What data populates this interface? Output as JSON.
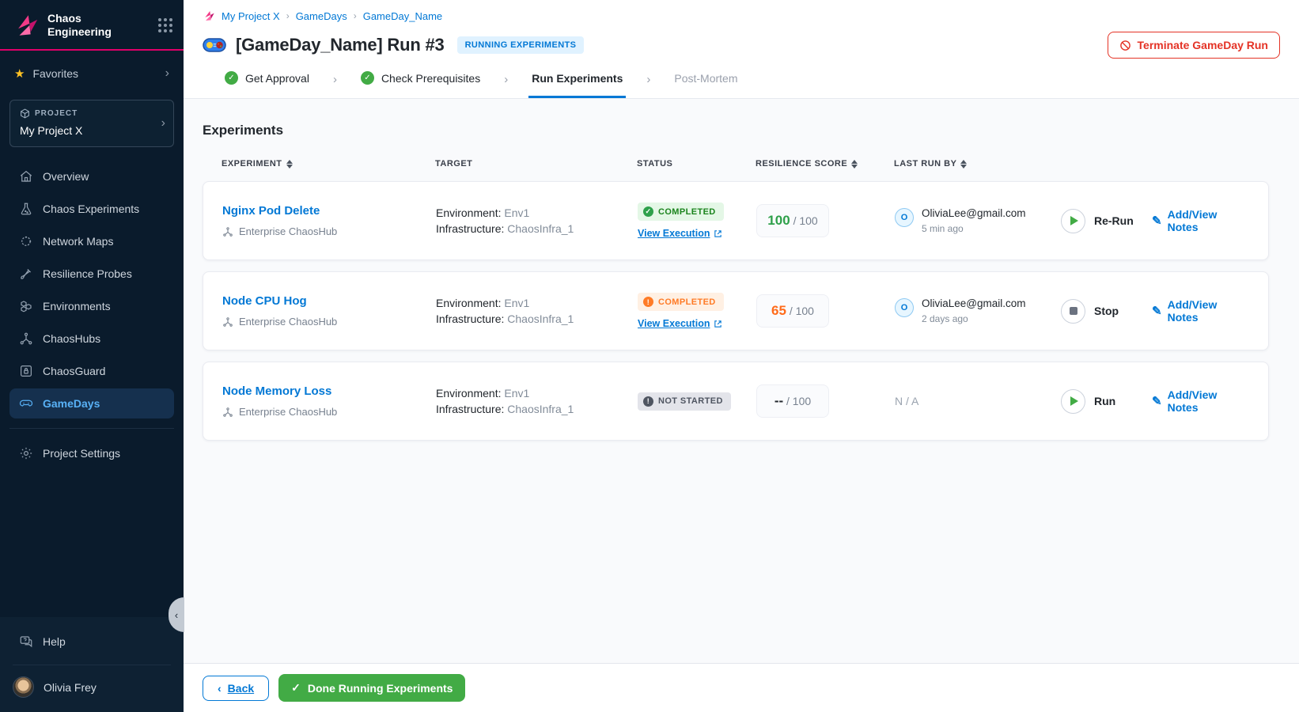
{
  "sidebar": {
    "brand": {
      "line1": "Chaos",
      "line2": "Engineering"
    },
    "favorites_label": "Favorites",
    "project": {
      "label": "PROJECT",
      "name": "My Project X"
    },
    "nav": [
      {
        "label": "Overview",
        "icon": "home-icon"
      },
      {
        "label": "Chaos Experiments",
        "icon": "flask-icon"
      },
      {
        "label": "Network Maps",
        "icon": "network-icon"
      },
      {
        "label": "Resilience Probes",
        "icon": "probe-icon"
      },
      {
        "label": "Environments",
        "icon": "hexagons-icon"
      },
      {
        "label": "ChaosHubs",
        "icon": "hub-icon"
      },
      {
        "label": "ChaosGuard",
        "icon": "lock-icon"
      },
      {
        "label": "GameDays",
        "icon": "gamepad-icon",
        "active": true
      }
    ],
    "settings_label": "Project Settings",
    "help_label": "Help",
    "user_name": "Olivia Frey"
  },
  "header": {
    "breadcrumb": [
      "My Project X",
      "GameDays",
      "GameDay_Name"
    ],
    "title": "[GameDay_Name] Run #3",
    "status_badge": "RUNNING EXPERIMENTS",
    "terminate_label": "Terminate GameDay Run",
    "steps": [
      {
        "label": "Get Approval",
        "state": "done"
      },
      {
        "label": "Check Prerequisites",
        "state": "done"
      },
      {
        "label": "Run Experiments",
        "state": "active"
      },
      {
        "label": "Post-Mortem",
        "state": "pending"
      }
    ]
  },
  "main": {
    "section_title": "Experiments",
    "columns": [
      "EXPERIMENT",
      "TARGET",
      "STATUS",
      "RESILIENCE SCORE",
      "LAST RUN BY"
    ],
    "target_labels": {
      "environment": "Environment:",
      "infrastructure": "Infrastructure:"
    },
    "rows": [
      {
        "name": "Nginx Pod Delete",
        "hub": "Enterprise ChaosHub",
        "environment": "Env1",
        "infrastructure": "ChaosInfra_1",
        "status": "COMPLETED",
        "view_execution": "View Execution",
        "score": "100",
        "score_max": "/ 100",
        "avatar_letter": "O",
        "run_by": "OliviaLee@gmail.com",
        "run_time": "5 min ago",
        "action": "Re-Run",
        "notes": "Add/View Notes"
      },
      {
        "name": "Node CPU Hog",
        "hub": "Enterprise ChaosHub",
        "environment": "Env1",
        "infrastructure": "ChaosInfra_1",
        "status": "COMPLETED",
        "view_execution": "View Execution",
        "score": "65",
        "score_max": "/ 100",
        "avatar_letter": "O",
        "run_by": "OliviaLee@gmail.com",
        "run_time": "2 days ago",
        "action": "Stop",
        "notes": "Add/View Notes"
      },
      {
        "name": "Node Memory Loss",
        "hub": "Enterprise ChaosHub",
        "environment": "Env1",
        "infrastructure": "ChaosInfra_1",
        "status": "NOT STARTED",
        "score": "--",
        "score_max": "/ 100",
        "na": "N / A",
        "action": "Run",
        "notes": "Add/View Notes"
      }
    ]
  },
  "footer": {
    "back_label": "Back",
    "done_label": "Done Running Experiments"
  },
  "colors": {
    "accent_blue": "#0278d5",
    "brand_pink": "#e0006a",
    "success_green": "#2ea04a",
    "warn_orange": "#ff7b26",
    "danger_red": "#e43326"
  }
}
